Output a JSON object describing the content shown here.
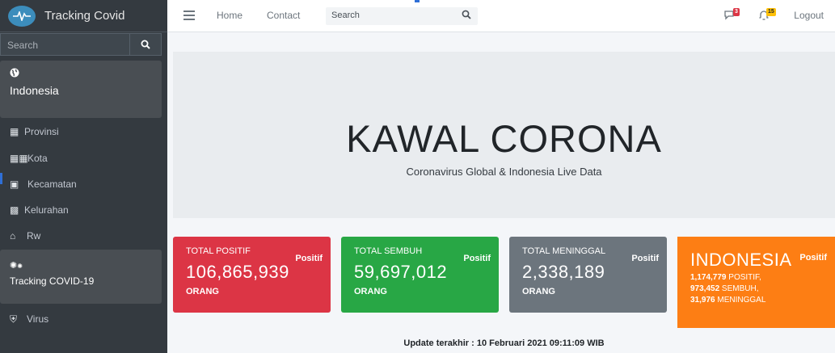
{
  "brand": {
    "title": "Tracking Covid",
    "logo_icon": "heartbeat-icon"
  },
  "sidebar": {
    "search_placeholder": "Search",
    "active": {
      "label": "Indonesia",
      "icon": "globe-icon"
    },
    "items": [
      {
        "label": "Provinsi",
        "icon": "building-icon"
      },
      {
        "label": "Kota",
        "icon": "city-icon"
      },
      {
        "label": "Kecamatan",
        "icon": "archway-icon"
      },
      {
        "label": "Kelurahan",
        "icon": "buildings-icon"
      },
      {
        "label": "Rw",
        "icon": "home-icon"
      }
    ],
    "tracking": {
      "label": "Tracking COVID-19",
      "icon": "cogs-icon"
    },
    "virus": {
      "label": "Virus",
      "icon": "shield-icon"
    }
  },
  "topbar": {
    "links": [
      "Home",
      "Contact"
    ],
    "search_placeholder": "Search",
    "messages_badge": "3",
    "notifications_badge": "15",
    "logout": "Logout"
  },
  "hero": {
    "title": "KAWAL CORONA",
    "subtitle": "Coronavirus Global & Indonesia Live Data"
  },
  "cards": [
    {
      "heading": "TOTAL POSITIF",
      "tag": "Positif",
      "value": "106,865,939",
      "unit": "ORANG",
      "color": "#dc3545"
    },
    {
      "heading": "TOTAL SEMBUH",
      "tag": "Positif",
      "value": "59,697,012",
      "unit": "ORANG",
      "color": "#28a745"
    },
    {
      "heading": "TOTAL MENINGGAL",
      "tag": "Positif",
      "value": "2,338,189",
      "unit": "ORANG",
      "color": "#6c757d"
    }
  ],
  "indonesia": {
    "title": "INDONESIA",
    "tag": "Positif",
    "positif_value": "1,174,779",
    "positif_label": " POSITIF,",
    "sembuh_value": "973,452",
    "sembuh_label": " SEMBUH,",
    "meninggal_value": "31,976",
    "meninggal_label": " MENINGGAL",
    "color": "#fd7e14"
  },
  "footer": {
    "label": "Update terakhir :",
    "value": "10 Februari 2021 09:11:09 WIB"
  }
}
